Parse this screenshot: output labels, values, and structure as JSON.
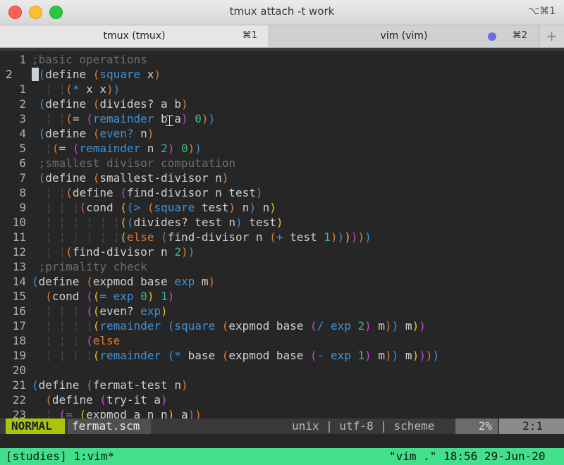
{
  "window": {
    "title": "tmux attach -t work",
    "shortcut": "⌥⌘1",
    "colors": {
      "close": "#fd5e57",
      "minimize": "#febc2e",
      "maximize": "#28c840"
    }
  },
  "tabs": [
    {
      "label": "tmux (tmux)",
      "key": "⌘1",
      "active": true
    },
    {
      "label": "vim (vim)",
      "key": "⌘2",
      "active": false,
      "indicator_color": "#6f6de0"
    }
  ],
  "new_tab_label": "+",
  "editor": {
    "lines": [
      {
        "num": "1",
        "cur": false,
        "segs": [
          [
            "cm",
            ";basic operations"
          ]
        ]
      },
      {
        "num": "2",
        "cur": true,
        "segs": [
          [
            "cursor",
            " "
          ],
          [
            "p1",
            "("
          ],
          [
            "kw",
            "define "
          ],
          [
            "p2",
            "("
          ],
          [
            "fn",
            "square"
          ],
          [
            "kw",
            " x"
          ],
          [
            "p2",
            ")"
          ]
        ]
      },
      {
        "num": "1",
        "cur": false,
        "segs": [
          [
            "g",
            "  ¦ ¦"
          ],
          [
            "p2",
            "("
          ],
          [
            "fn",
            "*"
          ],
          [
            "kw",
            " x x"
          ],
          [
            "p2",
            ")"
          ],
          [
            "p1",
            ")"
          ]
        ]
      },
      {
        "num": "2",
        "cur": false,
        "segs": [
          [
            "kw",
            " "
          ],
          [
            "p1",
            "("
          ],
          [
            "kw",
            "define "
          ],
          [
            "p2",
            "("
          ],
          [
            "kw",
            "divides? a b"
          ],
          [
            "p2",
            ")"
          ]
        ]
      },
      {
        "num": "3",
        "cur": false,
        "segs": [
          [
            "g",
            "  ¦ ¦"
          ],
          [
            "p2",
            "("
          ],
          [
            "kw",
            "= "
          ],
          [
            "p3",
            "("
          ],
          [
            "fn",
            "remainder"
          ],
          [
            "kw",
            " b a"
          ],
          [
            "p3",
            ")"
          ],
          [
            "kw",
            " "
          ],
          [
            "num",
            "0"
          ],
          [
            "p2",
            ")"
          ],
          [
            "p1",
            ")"
          ]
        ]
      },
      {
        "num": "4",
        "cur": false,
        "segs": [
          [
            "kw",
            " "
          ],
          [
            "p1",
            "("
          ],
          [
            "kw",
            "define "
          ],
          [
            "p2",
            "("
          ],
          [
            "fn",
            "even?"
          ],
          [
            "kw",
            " n"
          ],
          [
            "p2",
            ")"
          ]
        ]
      },
      {
        "num": "5",
        "cur": false,
        "segs": [
          [
            "g",
            "  ¦"
          ],
          [
            "p2",
            "("
          ],
          [
            "kw",
            "= "
          ],
          [
            "p3",
            "("
          ],
          [
            "fn",
            "remainder"
          ],
          [
            "kw",
            " n "
          ],
          [
            "num",
            "2"
          ],
          [
            "p3",
            ")"
          ],
          [
            "kw",
            " "
          ],
          [
            "num",
            "0"
          ],
          [
            "p2",
            ")"
          ],
          [
            "p1",
            ")"
          ]
        ]
      },
      {
        "num": "6",
        "cur": false,
        "segs": [
          [
            "cm",
            " ;smallest divisor computation"
          ]
        ]
      },
      {
        "num": "7",
        "cur": false,
        "segs": [
          [
            "kw",
            " "
          ],
          [
            "p1",
            "("
          ],
          [
            "kw",
            "define "
          ],
          [
            "p2",
            "("
          ],
          [
            "kw",
            "smallest-divisor n"
          ],
          [
            "p2",
            ")"
          ]
        ]
      },
      {
        "num": "8",
        "cur": false,
        "segs": [
          [
            "g",
            "  ¦ ¦"
          ],
          [
            "p2",
            "("
          ],
          [
            "kw",
            "define "
          ],
          [
            "p3",
            "("
          ],
          [
            "kw",
            "find-divisor n test"
          ],
          [
            "p3",
            ")"
          ]
        ]
      },
      {
        "num": "9",
        "cur": false,
        "segs": [
          [
            "g",
            "  ¦ ¦ ¦"
          ],
          [
            "p3",
            "("
          ],
          [
            "kw",
            "cond "
          ],
          [
            "p4",
            "("
          ],
          [
            "p1",
            "("
          ],
          [
            "fn",
            ">"
          ],
          [
            "kw",
            " "
          ],
          [
            "p2",
            "("
          ],
          [
            "fn",
            "square"
          ],
          [
            "kw",
            " test"
          ],
          [
            "p2",
            ")"
          ],
          [
            "kw",
            " n"
          ],
          [
            "p1",
            ")"
          ],
          [
            "kw",
            " n"
          ],
          [
            "p4",
            ")"
          ]
        ]
      },
      {
        "num": "10",
        "cur": false,
        "segs": [
          [
            "g",
            "  ¦ ¦ ¦ ¦ ¦ ¦"
          ],
          [
            "p4",
            "("
          ],
          [
            "p1",
            "("
          ],
          [
            "kw",
            "divides? test n"
          ],
          [
            "p1",
            ")"
          ],
          [
            "kw",
            " test"
          ],
          [
            "p4",
            ")"
          ]
        ]
      },
      {
        "num": "11",
        "cur": false,
        "segs": [
          [
            "g",
            "  ¦ ¦ ¦ ¦ ¦ ¦"
          ],
          [
            "p4",
            "("
          ],
          [
            "p2",
            "else "
          ],
          [
            "p1",
            "("
          ],
          [
            "kw",
            "find-divisor n "
          ],
          [
            "p2",
            "("
          ],
          [
            "fn",
            "+"
          ],
          [
            "kw",
            " test "
          ],
          [
            "num",
            "1"
          ],
          [
            "p2",
            ")"
          ],
          [
            "p1",
            ")"
          ],
          [
            "p4",
            ")"
          ],
          [
            "p3",
            ")"
          ],
          [
            "p2",
            ")"
          ],
          [
            "p1",
            ")"
          ]
        ]
      },
      {
        "num": "12",
        "cur": false,
        "segs": [
          [
            "g",
            "  ¦ ¦"
          ],
          [
            "p2",
            "("
          ],
          [
            "kw",
            "find-divisor n "
          ],
          [
            "num",
            "2"
          ],
          [
            "p2",
            ")"
          ],
          [
            "p1",
            ")"
          ]
        ]
      },
      {
        "num": "13",
        "cur": false,
        "segs": [
          [
            "cm",
            " ;primality check"
          ]
        ]
      },
      {
        "num": "14",
        "cur": false,
        "segs": [
          [
            "p1",
            "("
          ],
          [
            "kw",
            "define "
          ],
          [
            "p2",
            "("
          ],
          [
            "kw",
            "expmod base "
          ],
          [
            "fn",
            "exp"
          ],
          [
            "kw",
            " m"
          ],
          [
            "p2",
            ")"
          ]
        ]
      },
      {
        "num": "15",
        "cur": false,
        "segs": [
          [
            "kw",
            "  "
          ],
          [
            "p2",
            "("
          ],
          [
            "kw",
            "cond "
          ],
          [
            "p3",
            "("
          ],
          [
            "p4",
            "("
          ],
          [
            "fn",
            "="
          ],
          [
            "kw",
            " "
          ],
          [
            "fn",
            "exp"
          ],
          [
            "kw",
            " "
          ],
          [
            "num",
            "0"
          ],
          [
            "p4",
            ")"
          ],
          [
            "kw",
            " "
          ],
          [
            "num",
            "1"
          ],
          [
            "p3",
            ")"
          ]
        ]
      },
      {
        "num": "16",
        "cur": false,
        "segs": [
          [
            "g",
            "  ¦ ¦ ¦ "
          ],
          [
            "p3",
            "("
          ],
          [
            "p4",
            "("
          ],
          [
            "kw",
            "even? "
          ],
          [
            "fn",
            "exp"
          ],
          [
            "p4",
            ")"
          ]
        ]
      },
      {
        "num": "17",
        "cur": false,
        "segs": [
          [
            "g",
            "  ¦ ¦ ¦ ¦"
          ],
          [
            "p4",
            "("
          ],
          [
            "fn",
            "remainder"
          ],
          [
            "kw",
            " "
          ],
          [
            "p1",
            "("
          ],
          [
            "fn",
            "square"
          ],
          [
            "kw",
            " "
          ],
          [
            "p2",
            "("
          ],
          [
            "kw",
            "expmod base "
          ],
          [
            "p3",
            "("
          ],
          [
            "fn",
            "/"
          ],
          [
            "kw",
            " "
          ],
          [
            "fn",
            "exp"
          ],
          [
            "kw",
            " "
          ],
          [
            "num",
            "2"
          ],
          [
            "p3",
            ")"
          ],
          [
            "kw",
            " m"
          ],
          [
            "p2",
            ")"
          ],
          [
            "p1",
            ")"
          ],
          [
            "kw",
            " m"
          ],
          [
            "p4",
            ")"
          ],
          [
            "p3",
            ")"
          ]
        ]
      },
      {
        "num": "18",
        "cur": false,
        "segs": [
          [
            "g",
            "  ¦ ¦ ¦ "
          ],
          [
            "p3",
            "("
          ],
          [
            "p2",
            "else"
          ]
        ]
      },
      {
        "num": "19",
        "cur": false,
        "segs": [
          [
            "g",
            "  ¦ ¦ ¦ ¦"
          ],
          [
            "p4",
            "("
          ],
          [
            "fn",
            "remainder"
          ],
          [
            "kw",
            " "
          ],
          [
            "p1",
            "("
          ],
          [
            "fn",
            "*"
          ],
          [
            "kw",
            " base "
          ],
          [
            "p2",
            "("
          ],
          [
            "kw",
            "expmod base "
          ],
          [
            "p3",
            "("
          ],
          [
            "fn",
            "-"
          ],
          [
            "kw",
            " "
          ],
          [
            "fn",
            "exp"
          ],
          [
            "kw",
            " "
          ],
          [
            "num",
            "1"
          ],
          [
            "p3",
            ")"
          ],
          [
            "kw",
            " m"
          ],
          [
            "p2",
            ")"
          ],
          [
            "p1",
            ")"
          ],
          [
            "kw",
            " m"
          ],
          [
            "p4",
            ")"
          ],
          [
            "p3",
            ")"
          ],
          [
            "p2",
            ")"
          ],
          [
            "p1",
            ")"
          ]
        ]
      },
      {
        "num": "20",
        "cur": false,
        "segs": []
      },
      {
        "num": "21",
        "cur": false,
        "segs": [
          [
            "p1",
            "("
          ],
          [
            "kw",
            "define "
          ],
          [
            "p2",
            "("
          ],
          [
            "kw",
            "fermat-test n"
          ],
          [
            "p2",
            ")"
          ]
        ]
      },
      {
        "num": "22",
        "cur": false,
        "segs": [
          [
            "kw",
            "  "
          ],
          [
            "p2",
            "("
          ],
          [
            "kw",
            "define "
          ],
          [
            "p3",
            "("
          ],
          [
            "kw",
            "try-it a"
          ],
          [
            "p3",
            ")"
          ]
        ]
      },
      {
        "num": "23",
        "cur": false,
        "segs": [
          [
            "g",
            "  ¦ "
          ],
          [
            "p3",
            "("
          ],
          [
            "fn",
            "="
          ],
          [
            "kw",
            " "
          ],
          [
            "p4",
            "("
          ],
          [
            "kw",
            "expmod a n n"
          ],
          [
            "p4",
            ")"
          ],
          [
            "kw",
            " a"
          ],
          [
            "p3",
            ")"
          ],
          [
            "p2",
            ")"
          ]
        ]
      }
    ]
  },
  "vim_status": {
    "mode": "NORMAL",
    "filename": "fermat.scm",
    "info": "unix | utf-8 | scheme",
    "percent": "2%",
    "position": "2:1"
  },
  "tmux_status": {
    "left": "[studies] 1:vim*",
    "right": "\"vim .\" 18:56 29-Jun-20",
    "color": "#42e08c"
  }
}
